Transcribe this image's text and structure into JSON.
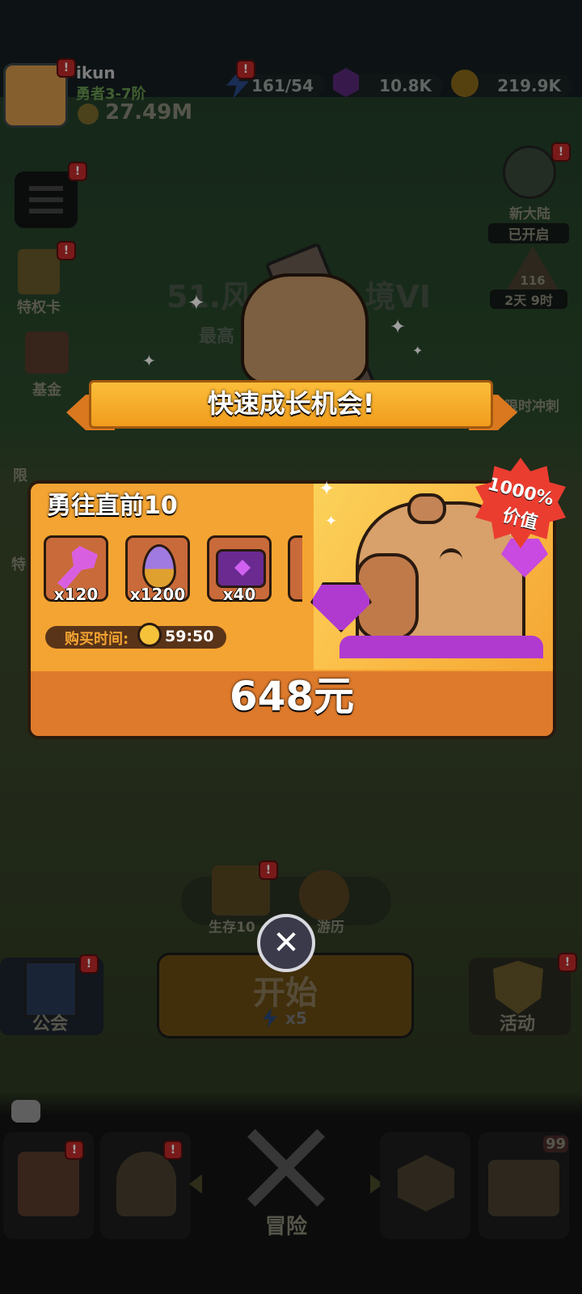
{
  "player": {
    "name": "ikun",
    "rank": "勇者3-7阶",
    "power": "27.49M"
  },
  "resources": {
    "energy": "161/54",
    "gems": "10.8K",
    "gold": "219.9K"
  },
  "side_left": {
    "privilege": "特权卡",
    "fund": "基金",
    "limited": "限",
    "special": "特"
  },
  "side_right": {
    "new_continent_line1": "新大陆",
    "new_continent_line2": "已开启",
    "season_level": "116",
    "season_time": "2天 9时",
    "sprint": "限时冲刺"
  },
  "stage": {
    "title_visible": "51.风",
    "title_visible_end": "境VI",
    "best_prefix": "最高"
  },
  "popup": {
    "banner": "快速成长机会!",
    "pack_title": "勇往直前10",
    "value_badge_pct": "1000%",
    "value_badge_word": "价值",
    "items": [
      {
        "icon": "pink-key-icon",
        "qty": "x120"
      },
      {
        "icon": "purple-egg-icon",
        "qty": "x1200"
      },
      {
        "icon": "purple-chest-icon",
        "qty": "x40"
      }
    ],
    "timer_label": "购买时间:",
    "timer_value": "59:50",
    "price": "648元"
  },
  "lower": {
    "survival": "生存10",
    "travel": "游历",
    "guild": "公会",
    "start": "开始",
    "start_cost": "x5",
    "event": "活动"
  },
  "nav": {
    "adventure": "冒险",
    "badge_99": "99"
  },
  "badge_mark": "!",
  "colors": {
    "banner": "#f6a622",
    "panel_top": "#f5a531",
    "panel_bottom": "#de7a2c",
    "badge_red": "#ee3a2e"
  }
}
